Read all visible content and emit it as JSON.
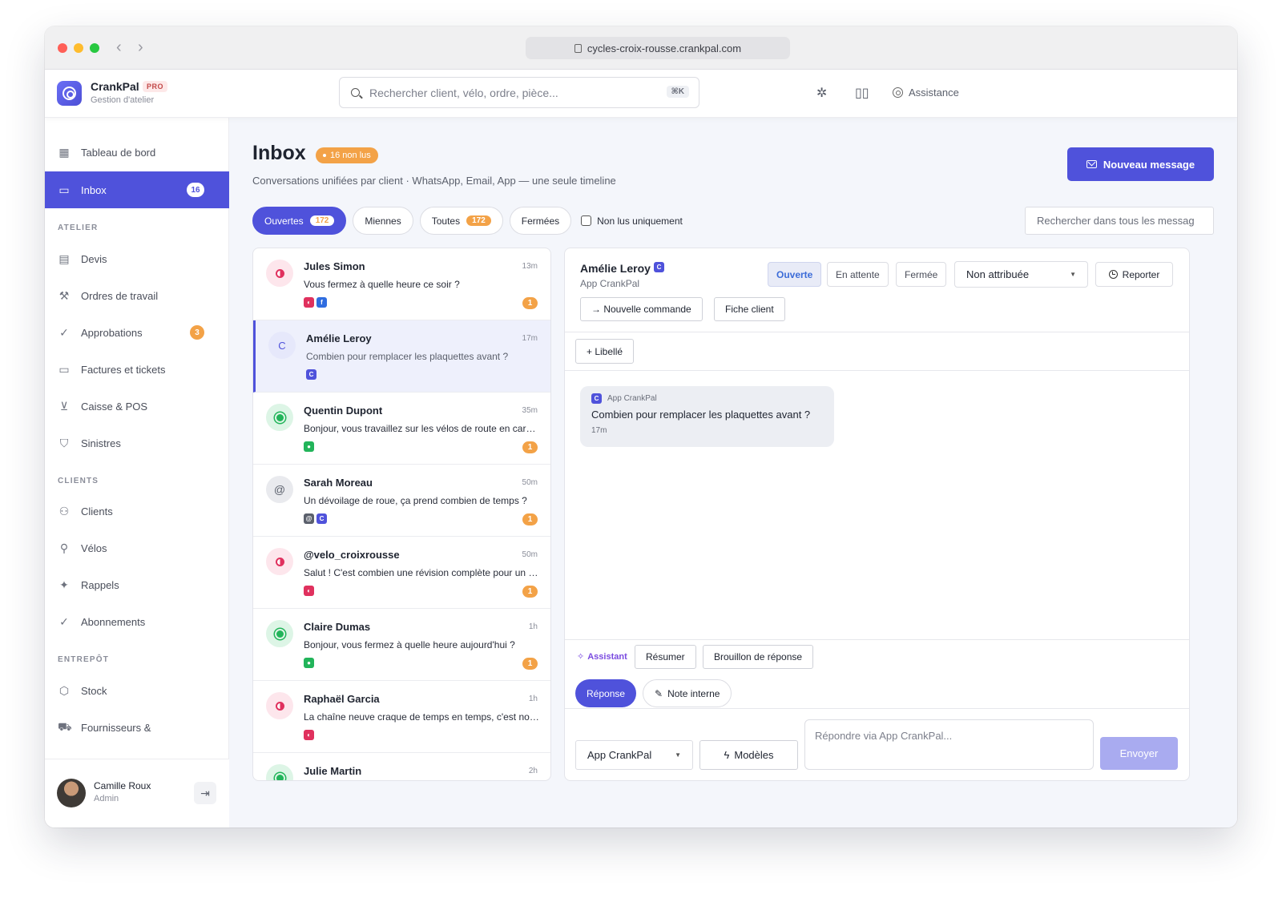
{
  "browser": {
    "url": "cycles-croix-rousse.crankpal.com"
  },
  "app": {
    "brand": "CrankPal",
    "tier": "PRO",
    "subtitle": "Gestion d'atelier",
    "search_placeholder": "Rechercher client, vélo, ordre, pièce...",
    "search_shortcut": "⌘K",
    "assistance_label": "Assistance"
  },
  "sidebar": {
    "top_items": [
      {
        "label": "Tableau de bord",
        "icon": "dashboard-icon"
      },
      {
        "label": "Inbox",
        "icon": "inbox-icon",
        "badge": "16",
        "active": true
      }
    ],
    "sections": [
      {
        "title": "ATELIER",
        "items": [
          {
            "label": "Devis",
            "icon": "document-icon"
          },
          {
            "label": "Ordres de travail",
            "icon": "wrench-icon"
          },
          {
            "label": "Approbations",
            "icon": "check-circle-icon",
            "badge": "3"
          },
          {
            "label": "Factures et tickets",
            "icon": "ticket-icon"
          },
          {
            "label": "Caisse & POS",
            "icon": "cart-icon"
          },
          {
            "label": "Sinistres",
            "icon": "shield-icon"
          }
        ]
      },
      {
        "title": "CLIENTS",
        "items": [
          {
            "label": "Clients",
            "icon": "users-icon"
          },
          {
            "label": "Vélos",
            "icon": "bike-icon"
          },
          {
            "label": "Rappels",
            "icon": "sparkle-icon"
          },
          {
            "label": "Abonnements",
            "icon": "check-circle-icon"
          }
        ]
      },
      {
        "title": "ENTREPÔT",
        "items": [
          {
            "label": "Stock",
            "icon": "box-icon"
          },
          {
            "label": "Fournisseurs &",
            "icon": "truck-icon"
          }
        ]
      }
    ],
    "user": {
      "name": "Camille Roux",
      "role": "Admin"
    }
  },
  "page": {
    "title": "Inbox",
    "unread_badge": "16 non lus",
    "subtitle": "Conversations unifiées par client · WhatsApp, Email, App — une seule timeline",
    "new_message_label": "Nouveau message",
    "filters": [
      {
        "label": "Ouvertes",
        "count": "172",
        "active": true
      },
      {
        "label": "Miennes"
      },
      {
        "label": "Toutes",
        "count": "172"
      },
      {
        "label": "Fermées"
      }
    ],
    "unread_only_label": "Non lus uniquement",
    "global_search_placeholder": "Rechercher dans tous les messag"
  },
  "conversations": [
    {
      "name": "Jules Simon",
      "time": "13m",
      "preview": "Vous fermez à quelle heure ce soir ?",
      "avatar": "instagram",
      "channels": [
        "instagram",
        "facebook"
      ],
      "unread": "1"
    },
    {
      "name": "Amélie Leroy",
      "time": "17m",
      "preview": "Combien pour remplacer les plaquettes avant ?",
      "avatar": "app",
      "avatar_text": "C",
      "channels": [
        "app"
      ],
      "selected": true
    },
    {
      "name": "Quentin Dupont",
      "time": "35m",
      "preview": "Bonjour, vous travaillez sur les vélos de route en carbone ?",
      "avatar": "whatsapp",
      "channels": [
        "whatsapp"
      ],
      "unread": "1"
    },
    {
      "name": "Sarah Moreau",
      "time": "50m",
      "preview": "Un dévoilage de roue, ça prend combien de temps ?",
      "avatar": "email",
      "avatar_text": "@",
      "channels": [
        "email",
        "app"
      ],
      "unread": "1"
    },
    {
      "name": "@velo_croixrousse",
      "time": "50m",
      "preview": "Salut ! C'est combien une révision complète pour un VTT ?",
      "avatar": "instagram",
      "channels": [
        "instagram"
      ],
      "unread": "1"
    },
    {
      "name": "Claire Dumas",
      "time": "1h",
      "preview": "Bonjour, vous fermez à quelle heure aujourd'hui ?",
      "avatar": "whatsapp",
      "channels": [
        "whatsapp"
      ],
      "unread": "1"
    },
    {
      "name": "Raphaël Garcia",
      "time": "1h",
      "preview": "La chaîne neuve craque de temps en temps, c'est normal ?",
      "avatar": "instagram",
      "channels": [
        "instagram"
      ]
    },
    {
      "name": "Julie Martin",
      "time": "2h",
      "preview": "",
      "avatar": "whatsapp",
      "channels": []
    }
  ],
  "detail": {
    "name": "Amélie Leroy",
    "name_badge": "C",
    "channel": "App CrankPal",
    "statuses": [
      "Ouverte",
      "En attente",
      "Fermée"
    ],
    "active_status": "Ouverte",
    "assignee": "Non attribuée",
    "report_label": "Reporter",
    "actions": [
      "→ Nouvelle commande",
      "Fiche client"
    ],
    "label_button": "+ Libellé",
    "message": {
      "channel_badge": "C",
      "channel": "App CrankPal",
      "text": "Combien pour remplacer les plaquettes avant ?",
      "time": "17m"
    },
    "assistant_label": "Assistant",
    "assistant_actions": [
      "Résumer",
      "Brouillon de réponse"
    ],
    "modes": [
      "Réponse",
      "Note interne"
    ],
    "reply_channel": "App CrankPal",
    "templates_label": "Modèles",
    "reply_placeholder": "Répondre via App CrankPal...",
    "send_label": "Envoyer"
  },
  "colors": {
    "accent": "#4f52db",
    "warning": "#f3a247",
    "whatsapp": "#22b45a",
    "instagram": "#e0315e",
    "facebook": "#2f6de0"
  }
}
